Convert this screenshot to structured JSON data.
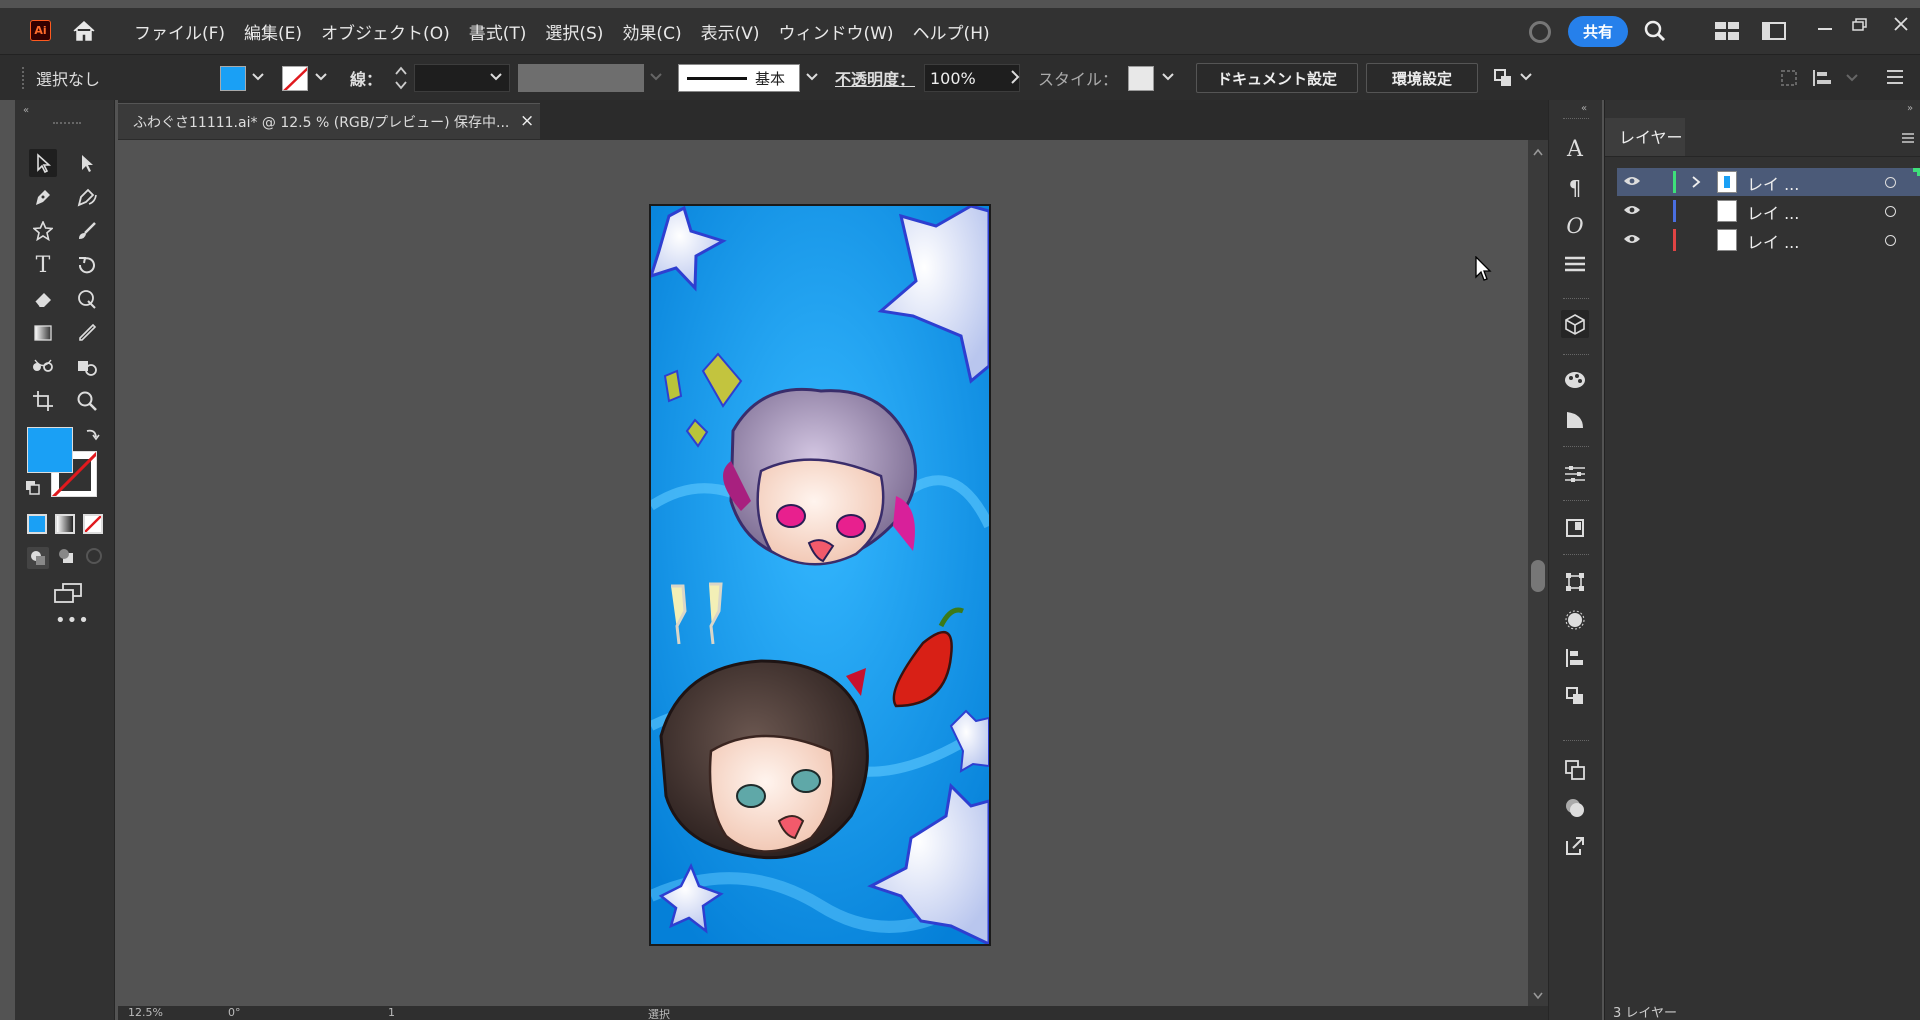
{
  "app": {
    "logo": "Ai"
  },
  "menu": [
    "ファイル(F)",
    "編集(E)",
    "オブジェクト(O)",
    "書式(T)",
    "選択(S)",
    "効果(C)",
    "表示(V)",
    "ウィンドウ(W)",
    "ヘルプ(H)"
  ],
  "share_label": "共有",
  "control": {
    "selection": "選択なし",
    "stroke_label": "線：",
    "stroke_style": "基本",
    "opacity_label": "不透明度：",
    "opacity_value": "100%",
    "style_label": "スタイル：",
    "doc_settings": "ドキュメント設定",
    "prefs": "環境設定"
  },
  "document": {
    "tab_title": "ふわぐさ11111.ai* @ 12.5 % (RGB/プレビュー) 保存中..."
  },
  "layers_panel": {
    "tab": "レイヤー",
    "rows": [
      {
        "name": "レイ ...",
        "color": "#3ee07a"
      },
      {
        "name": "レイ ...",
        "color": "#4a6fe0"
      },
      {
        "name": "レイ ...",
        "color": "#e04444"
      }
    ],
    "footer": "3 レイヤー"
  },
  "status": {
    "zoom": "12.5%",
    "angle": "0°",
    "page": "1",
    "mode": "選択"
  },
  "colors": {
    "fill": "#1aa0f5",
    "accent": "#2680eb",
    "artwork_bg": "#0aa3f6"
  }
}
